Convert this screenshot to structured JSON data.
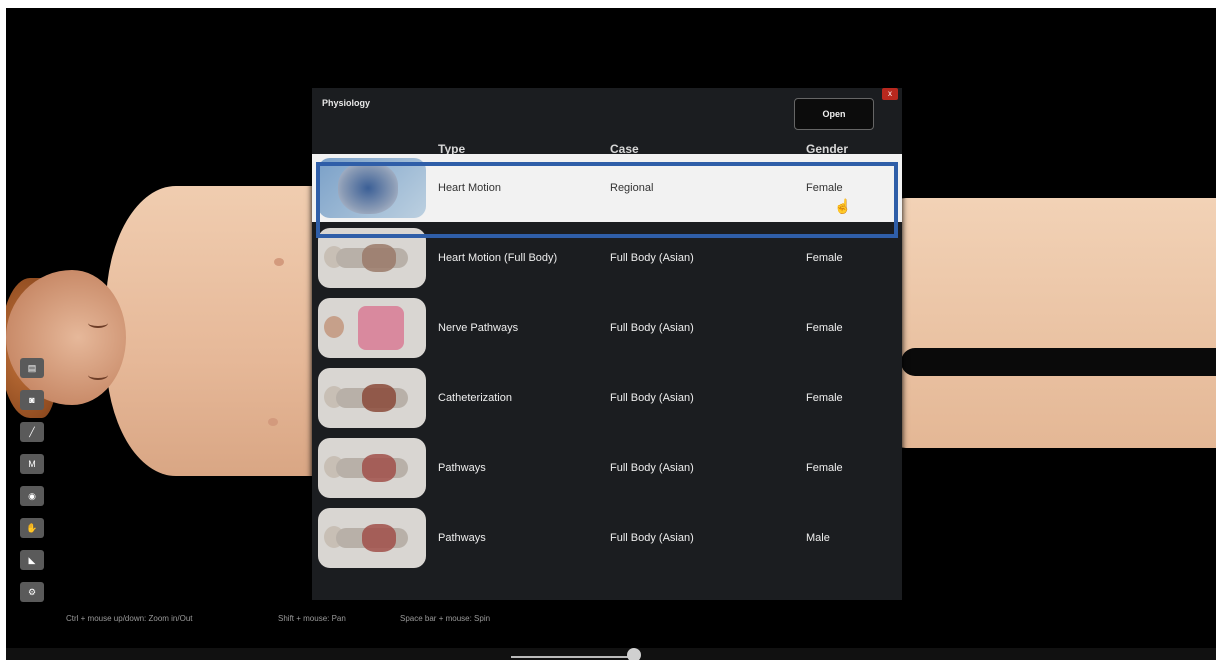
{
  "dialog": {
    "title": "Physiology",
    "open_label": "Open",
    "close_glyph": "x",
    "columns": {
      "type": "Type",
      "case": "Case",
      "gender": "Gender"
    },
    "rows": [
      {
        "type": "Heart Motion",
        "case": "Regional",
        "gender": "Female",
        "thumb_icon": "heart-thumbnail-icon",
        "selected": true
      },
      {
        "type": "Heart Motion (Full Body)",
        "case": "Full Body (Asian)",
        "gender": "Female",
        "thumb_icon": "fullbody-thumbnail-icon",
        "selected": false
      },
      {
        "type": "Nerve Pathways",
        "case": "Full Body (Asian)",
        "gender": "Female",
        "thumb_icon": "nerve-thumbnail-icon",
        "selected": false
      },
      {
        "type": "Catheterization",
        "case": "Full Body (Asian)",
        "gender": "Female",
        "thumb_icon": "catheter-thumbnail-icon",
        "selected": false
      },
      {
        "type": "Pathways",
        "case": "Full Body (Asian)",
        "gender": "Female",
        "thumb_icon": "pathways-thumbnail-icon",
        "selected": false
      },
      {
        "type": "Pathways",
        "case": "Full Body (Asian)",
        "gender": "Male",
        "thumb_icon": "pathways-thumbnail-icon",
        "selected": false
      }
    ]
  },
  "hints": {
    "zoom": "Ctrl + mouse up/down: Zoom in/Out",
    "pan": "Shift + mouse: Pan",
    "spin": "Space bar + mouse: Spin"
  },
  "toolbar": {
    "measure_label": "M"
  },
  "colors": {
    "selection_outline": "#2f5ea8",
    "dialog_bg": "#1b1d20",
    "selected_row_bg": "#f2f2f2"
  }
}
